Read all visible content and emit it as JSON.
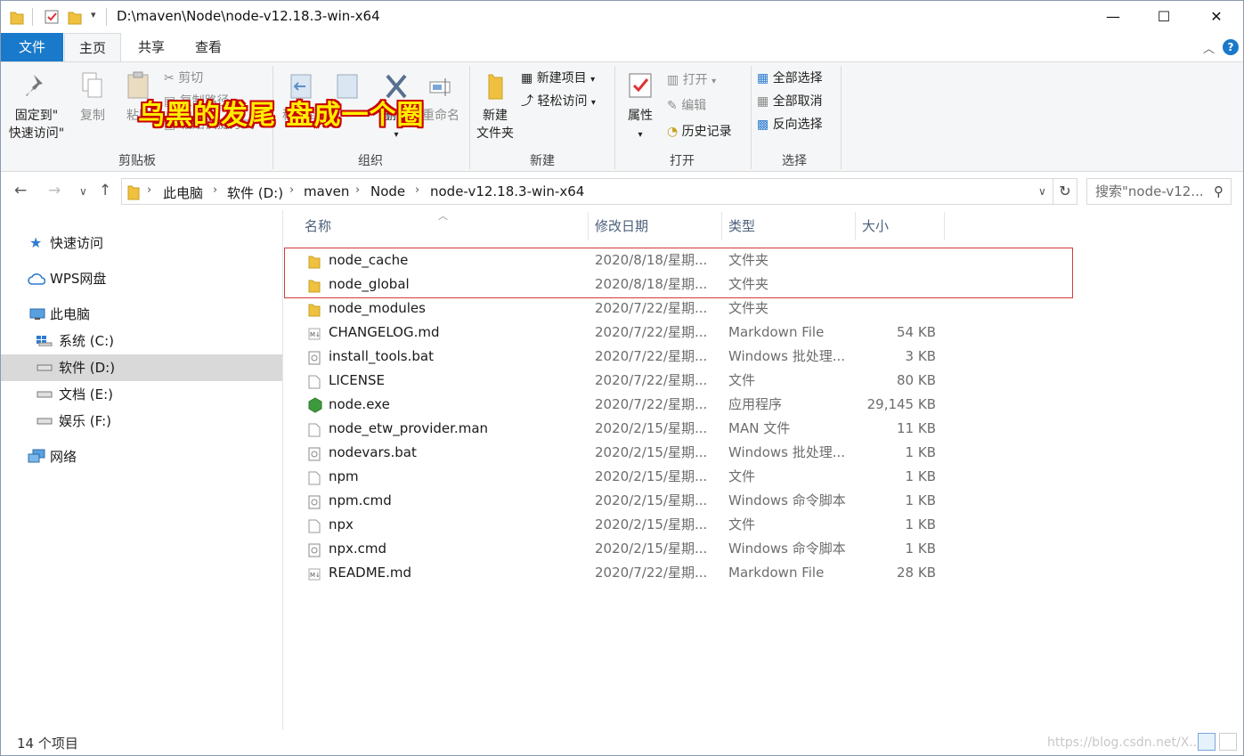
{
  "window": {
    "title": "D:\\maven\\Node\\node-v12.18.3-win-x64",
    "controls": {
      "minimize": "—",
      "maximize": "☐",
      "close": "✕"
    }
  },
  "ribbon_tabs": [
    {
      "label": "文件"
    },
    {
      "label": "主页"
    },
    {
      "label": "共享"
    },
    {
      "label": "查看"
    }
  ],
  "ribbon": {
    "clipboard": {
      "pin_label_1": "固定到\"",
      "pin_label_2": "快速访问\"",
      "copy_label": "复制",
      "paste_label": "粘贴",
      "cut_label": "剪切",
      "copy_path_label": "复制路径",
      "paste_shortcut_label": "粘贴快捷方式",
      "group_label": "剪贴板"
    },
    "organize": {
      "move_label": "移动到",
      "copy_to_label": "复制到",
      "delete_label": "删除",
      "rename_label": "重命名",
      "group_label": "组织"
    },
    "new": {
      "new_folder_label_1": "新建",
      "new_folder_label_2": "文件夹",
      "new_item_label": "新建项目",
      "easy_access_label": "轻松访问",
      "group_label": "新建"
    },
    "open": {
      "properties_label": "属性",
      "open_label": "打开",
      "edit_label": "编辑",
      "history_label": "历史记录",
      "group_label": "打开"
    },
    "select": {
      "select_all_label": "全部选择",
      "select_none_label": "全部取消",
      "invert_label": "反向选择",
      "group_label": "选择"
    }
  },
  "overlay_text": "乌黑的发尾 盘成一个圈",
  "address": {
    "breadcrumbs": [
      "此电脑",
      "软件 (D:)",
      "maven",
      "Node",
      "node-v12.18.3-win-x64"
    ],
    "search_placeholder": "搜索\"node-v12..."
  },
  "nav_pane": {
    "items": [
      {
        "label": "快速访问"
      },
      {
        "label": "WPS网盘"
      },
      {
        "label": "此电脑"
      },
      {
        "label": "系统 (C:)"
      },
      {
        "label": "软件 (D:)"
      },
      {
        "label": "文档 (E:)"
      },
      {
        "label": "娱乐 (F:)"
      },
      {
        "label": "网络"
      }
    ]
  },
  "columns": {
    "name": "名称",
    "modified": "修改日期",
    "type": "类型",
    "size": "大小"
  },
  "files": [
    {
      "name": "node_cache",
      "modified": "2020/8/18/星期...",
      "type": "文件夹",
      "size": "",
      "icon": "folder-icon"
    },
    {
      "name": "node_global",
      "modified": "2020/8/18/星期...",
      "type": "文件夹",
      "size": "",
      "icon": "folder-icon"
    },
    {
      "name": "node_modules",
      "modified": "2020/7/22/星期...",
      "type": "文件夹",
      "size": "",
      "icon": "folder-icon"
    },
    {
      "name": "CHANGELOG.md",
      "modified": "2020/7/22/星期...",
      "type": "Markdown File",
      "size": "54 KB",
      "icon": "markdown-icon"
    },
    {
      "name": "install_tools.bat",
      "modified": "2020/7/22/星期...",
      "type": "Windows 批处理...",
      "size": "3 KB",
      "icon": "batch-file-icon"
    },
    {
      "name": "LICENSE",
      "modified": "2020/7/22/星期...",
      "type": "文件",
      "size": "80 KB",
      "icon": "file-icon"
    },
    {
      "name": "node.exe",
      "modified": "2020/7/22/星期...",
      "type": "应用程序",
      "size": "29,145 KB",
      "icon": "node-exe-icon"
    },
    {
      "name": "node_etw_provider.man",
      "modified": "2020/2/15/星期...",
      "type": "MAN 文件",
      "size": "11 KB",
      "icon": "file-icon"
    },
    {
      "name": "nodevars.bat",
      "modified": "2020/2/15/星期...",
      "type": "Windows 批处理...",
      "size": "1 KB",
      "icon": "batch-file-icon"
    },
    {
      "name": "npm",
      "modified": "2020/2/15/星期...",
      "type": "文件",
      "size": "1 KB",
      "icon": "file-icon"
    },
    {
      "name": "npm.cmd",
      "modified": "2020/2/15/星期...",
      "type": "Windows 命令脚本",
      "size": "1 KB",
      "icon": "batch-file-icon"
    },
    {
      "name": "npx",
      "modified": "2020/2/15/星期...",
      "type": "文件",
      "size": "1 KB",
      "icon": "file-icon"
    },
    {
      "name": "npx.cmd",
      "modified": "2020/2/15/星期...",
      "type": "Windows 命令脚本",
      "size": "1 KB",
      "icon": "batch-file-icon"
    },
    {
      "name": "README.md",
      "modified": "2020/7/22/星期...",
      "type": "Markdown File",
      "size": "28 KB",
      "icon": "markdown-icon"
    }
  ],
  "status": {
    "item_count": "14 个项目",
    "watermark": "https://blog.csdn.net/X..."
  },
  "colors": {
    "accent": "#1979ca",
    "highlight_box": "#d43b3b",
    "folder": "#f0c040"
  }
}
